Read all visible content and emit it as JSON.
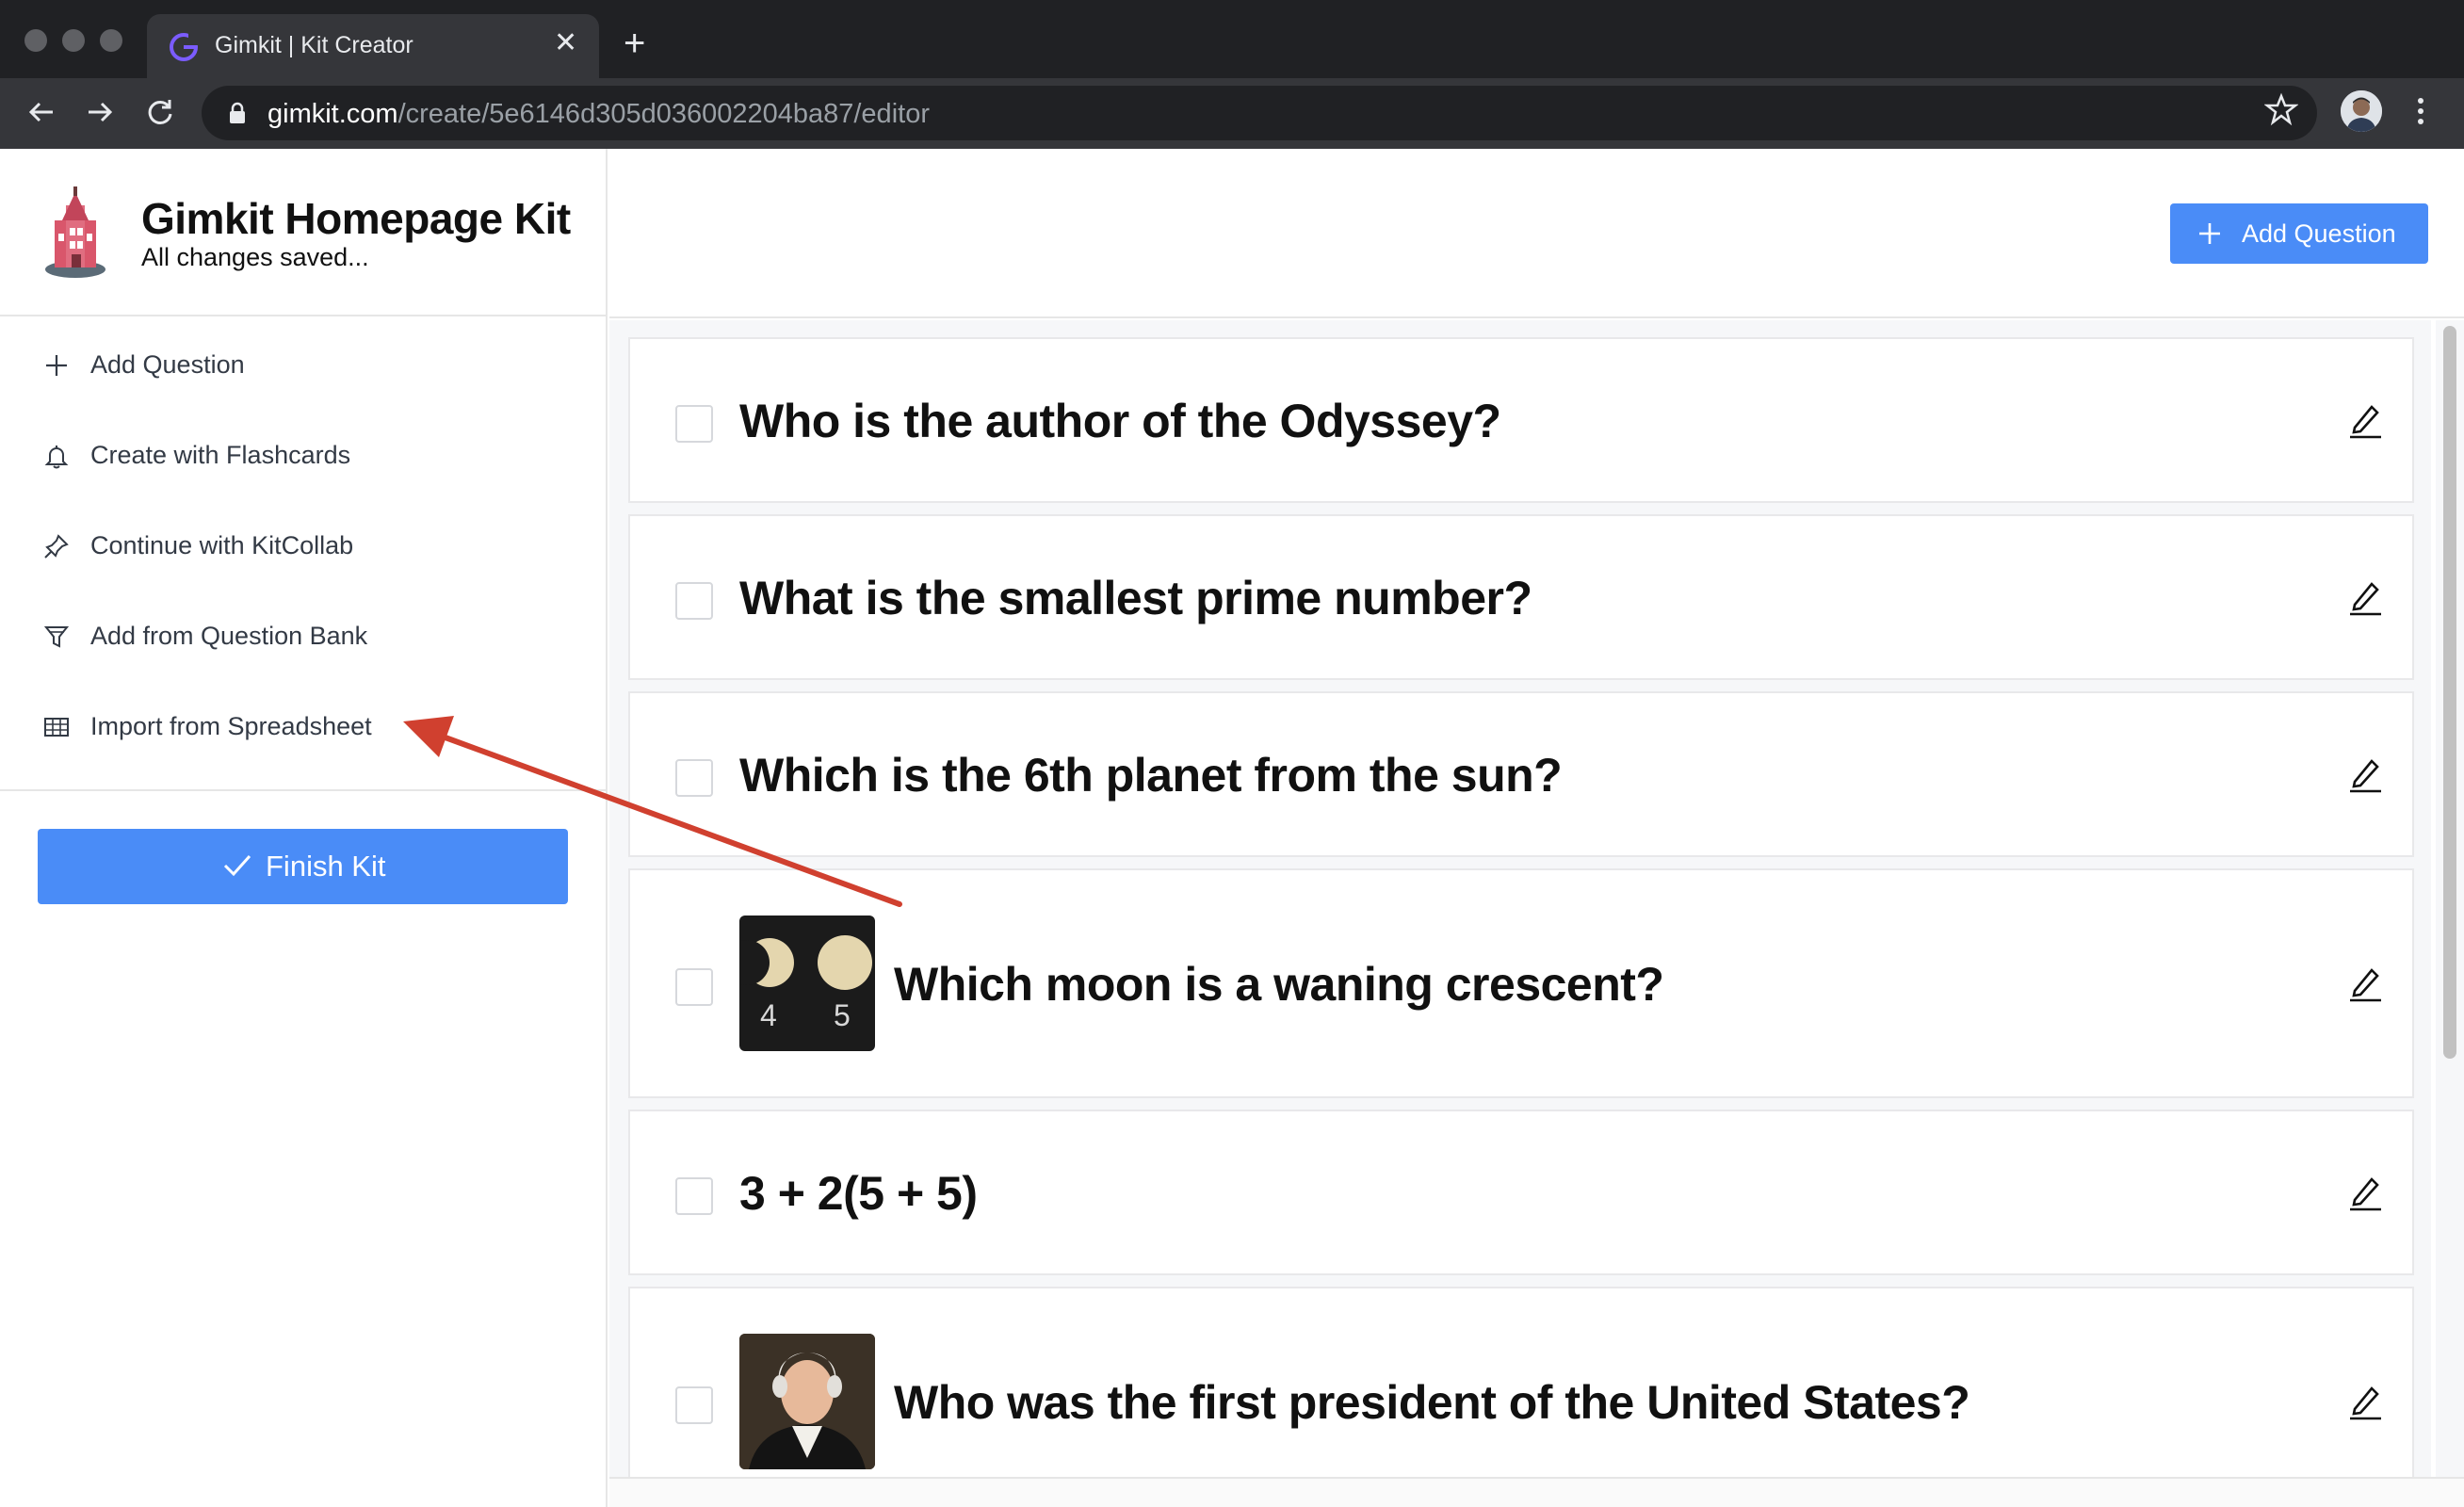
{
  "browser": {
    "tab_title": "Gimkit | Kit Creator",
    "url_host": "gimkit.com",
    "url_path": "/create/5e6146d305d036002204ba87/editor"
  },
  "kit": {
    "title": "Gimkit Homepage Kit",
    "status": "All changes saved..."
  },
  "sidebar": {
    "items": [
      {
        "label": "Add Question",
        "icon": "plus-icon"
      },
      {
        "label": "Create with Flashcards",
        "icon": "bell-icon"
      },
      {
        "label": "Continue with KitCollab",
        "icon": "pin-icon"
      },
      {
        "label": "Add from Question Bank",
        "icon": "funnel-icon"
      },
      {
        "label": "Import from Spreadsheet",
        "icon": "table-icon"
      }
    ],
    "finish_label": "Finish Kit"
  },
  "toolbar": {
    "add_question_label": "Add Question"
  },
  "questions": [
    {
      "text": "Who is the author of the Odyssey?"
    },
    {
      "text": "What is the smallest prime number?"
    },
    {
      "text": "Which is the 6th planet from the sun?"
    },
    {
      "text": "Which moon is a waning crescent?",
      "image_labels": [
        "4",
        "5"
      ]
    },
    {
      "text": "3 + 2(5 + 5)"
    },
    {
      "text": "Who was the first president of the United States?"
    }
  ],
  "colors": {
    "primary": "#4a8cf7",
    "annotation_arrow": "#d0402f"
  }
}
